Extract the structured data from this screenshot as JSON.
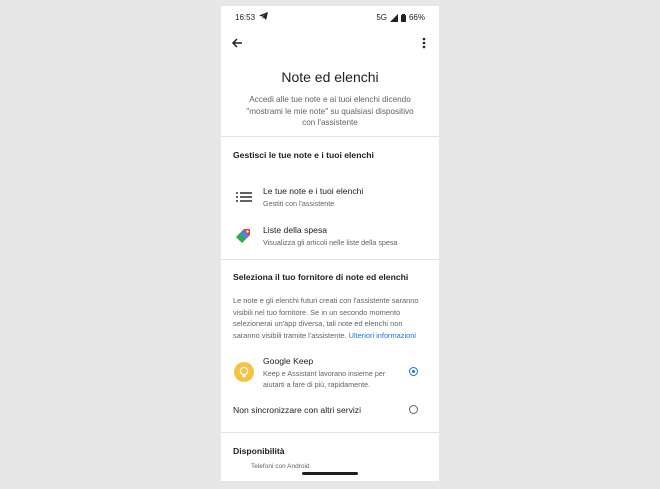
{
  "status": {
    "time": "16:53",
    "network": "5G",
    "battery": "66%"
  },
  "appbar": {
    "back_icon": "arrow-back-icon",
    "menu_icon": "more-vert-icon"
  },
  "header": {
    "title": "Note ed elenchi",
    "subtitle": "Accedi alle tue note e ai tuoi elenchi dicendo \"mostrami le mie note\" su qualsiasi dispositivo con l'assistente"
  },
  "manage": {
    "heading": "Gestisci le tue note e i tuoi elenchi",
    "items": [
      {
        "title": "Le tue note e i tuoi elenchi",
        "subtitle": "Gestiti con l'assistente",
        "icon": "list-icon"
      },
      {
        "title": "Liste della spesa",
        "subtitle": "Visualizza gli articoli nelle liste della spesa",
        "icon": "shopping-tag-icon"
      }
    ]
  },
  "provider": {
    "heading": "Seleziona il tuo fornitore di note ed elenchi",
    "description": "Le note e gli elenchi futuri creati con l'assistente saranno visibili nel tuo fornitore. Se in un secondo momento selezionerai un'app diversa, tali note ed elenchi non saranno visibili tramite l'assistente.",
    "link": "Ulteriori informazioni",
    "options": [
      {
        "title": "Google Keep",
        "subtitle": "Keep e Assistant lavorano insieme per aiutarti a fare di più, rapidamente.",
        "selected": true,
        "icon": "google-keep-icon"
      },
      {
        "title": "Non sincronizzare con altri servizi",
        "selected": false
      }
    ]
  },
  "availability": {
    "heading": "Disponibilità",
    "partial": "Telefoni con Android"
  },
  "colors": {
    "accent": "#1a73e8",
    "keep": "#f5c342"
  }
}
